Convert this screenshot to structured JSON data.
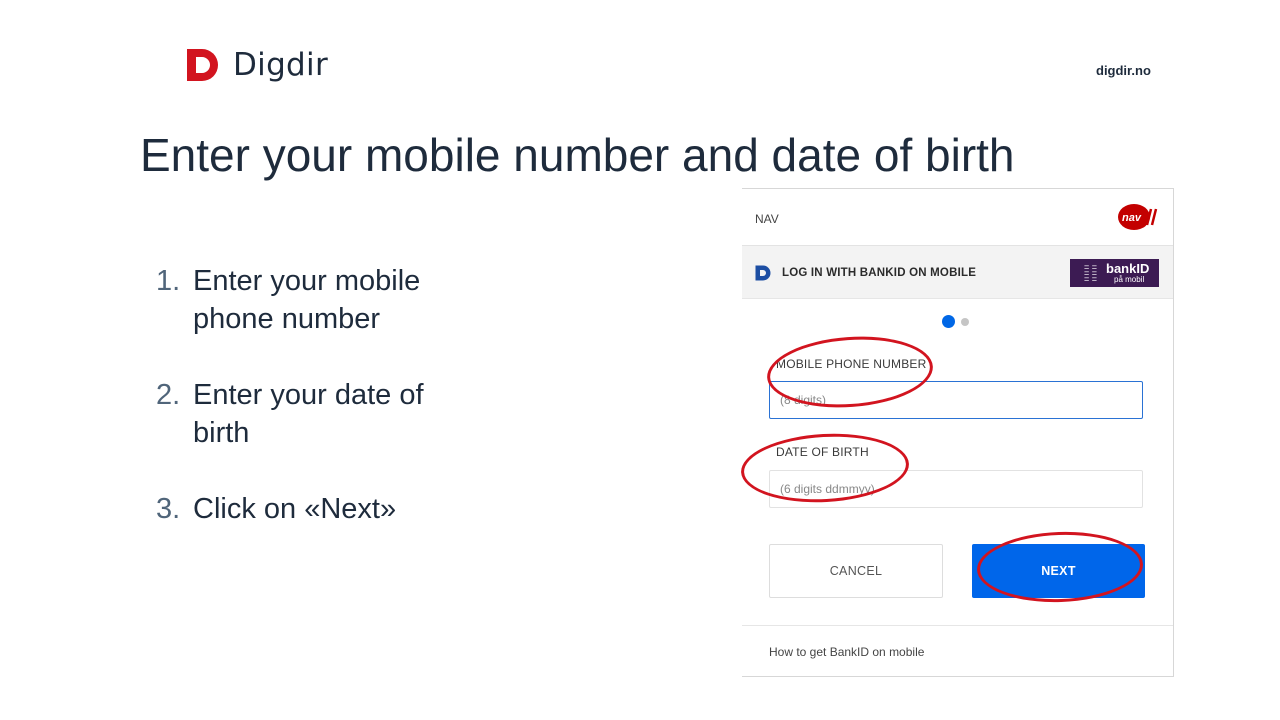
{
  "header": {
    "logo_text": "Digdir",
    "site_link": "digdir.no",
    "brand_color": "#d2141f"
  },
  "headline": "Enter your mobile number and date of birth",
  "steps": [
    {
      "num": "1.",
      "text": "Enter your mobile phone number"
    },
    {
      "num": "2.",
      "text": "Enter your date of birth"
    },
    {
      "num": "3.",
      "text": "Click on «Next»"
    }
  ],
  "login": {
    "provider": "NAV",
    "provider_logo_text": "nav",
    "method_title": "LOG IN WITH BANKID ON MOBILE",
    "bankid_logo": {
      "main": "bankID",
      "sub": "på mobil"
    },
    "step_indicator": {
      "current": 1,
      "total": 2
    },
    "phone": {
      "label": "MOBILE PHONE NUMBER",
      "placeholder": "(8 digits)",
      "value": ""
    },
    "dob": {
      "label": "DATE OF BIRTH",
      "placeholder": "(6 digits ddmmyy)",
      "value": ""
    },
    "cancel_label": "CANCEL",
    "next_label": "NEXT",
    "help_link": "How to get BankID on mobile",
    "accent_color": "#0066ea"
  },
  "annotation_color": "#d2141f"
}
